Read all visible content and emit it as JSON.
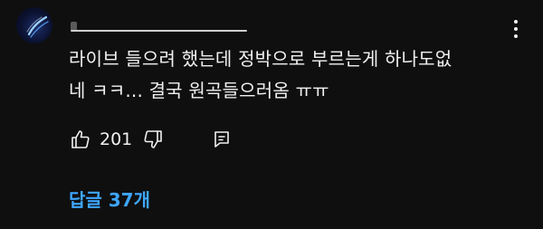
{
  "comment": {
    "author_placeholder": "",
    "text_line1": "라이브 들으려 했는데 정박으로 부르는게 하나도없",
    "text_line2": "네 ㅋㅋ... 결국 원곡들으러옴 ㅠㅠ",
    "like_count": "201",
    "replies_label": "답글 37개"
  },
  "icons": {
    "avatar": "avatar-image",
    "menu": "more-vertical-icon",
    "like": "thumbs-up-icon",
    "dislike": "thumbs-down-icon",
    "reply": "reply-icon"
  },
  "colors": {
    "background": "#0f0f0f",
    "text": "#f1f1f1",
    "link": "#3ea6ff"
  }
}
